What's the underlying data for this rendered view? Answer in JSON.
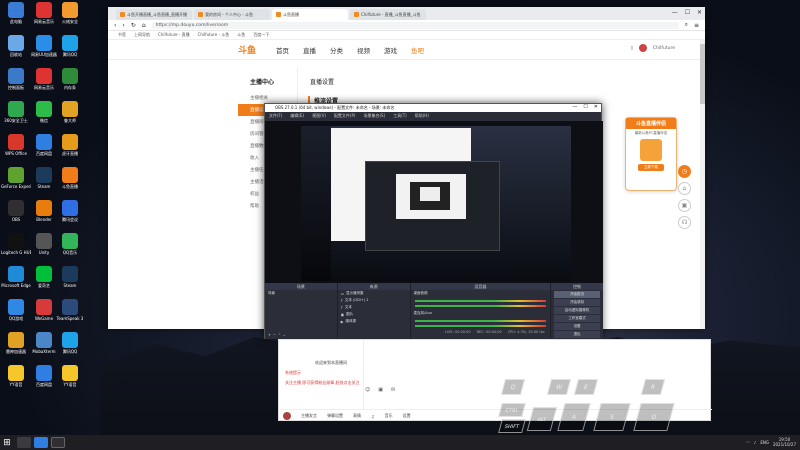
{
  "desktop": {
    "icons": [
      {
        "label": "此电脑",
        "color": "#3a7bd5"
      },
      {
        "label": "网易云音乐",
        "color": "#d33"
      },
      {
        "label": "火绒安全",
        "color": "#f29a2e"
      },
      {
        "label": "回收站",
        "color": "#6aa8e8"
      },
      {
        "label": "网易UU加速器",
        "color": "#2a8ee8"
      },
      {
        "label": "腾讯QQ",
        "color": "#1fa3e8"
      },
      {
        "label": "控制面板",
        "color": "#3d79c9"
      },
      {
        "label": "网易云音乐",
        "color": "#d33"
      },
      {
        "label": "内存条",
        "color": "#2f8a3a"
      },
      {
        "label": "360安全卫士",
        "color": "#2fa84f"
      },
      {
        "label": "微信",
        "color": "#2dbb4a"
      },
      {
        "label": "鲁大师",
        "color": "#e2a324"
      },
      {
        "label": "WPS Office",
        "color": "#d9362c"
      },
      {
        "label": "百度网盘",
        "color": "#2f7fe3"
      },
      {
        "label": "虎牙直播",
        "color": "#e69b1a"
      },
      {
        "label": "GeForce Experience",
        "color": "#5fa32e"
      },
      {
        "label": "Steam",
        "color": "#1c3b5a"
      },
      {
        "label": "斗鱼直播",
        "color": "#f07d1a"
      },
      {
        "label": "OBS",
        "color": "#302e31"
      },
      {
        "label": "Blender",
        "color": "#e87d0d"
      },
      {
        "label": "腾讯会议",
        "color": "#2f6fe3"
      },
      {
        "label": "Logitech G HUB",
        "color": "#111"
      },
      {
        "label": "Unity",
        "color": "#555"
      },
      {
        "label": "QQ音乐",
        "color": "#33b65a"
      },
      {
        "label": "Microsoft Edge",
        "color": "#1f8ad6"
      },
      {
        "label": "爱奇艺",
        "color": "#00bf3a"
      },
      {
        "label": "Steam",
        "color": "#1c3b5a"
      },
      {
        "label": "QQ游戏",
        "color": "#2f88e3"
      },
      {
        "label": "WeGame",
        "color": "#d73a3a"
      },
      {
        "label": "TeamSpeak 3",
        "color": "#2b4c7a"
      },
      {
        "label": "雷神加速器",
        "color": "#e0a124"
      },
      {
        "label": "MobaXterm",
        "color": "#4a86c8"
      },
      {
        "label": "腾讯QQ",
        "color": "#1fa3e8"
      },
      {
        "label": "YY语音",
        "color": "#f5c72a"
      },
      {
        "label": "百度网盘",
        "color": "#2f7fe3"
      },
      {
        "label": "YY语音",
        "color": "#f5c72a"
      }
    ],
    "taskbar": {
      "time": "19:50",
      "date": "2021/10/27",
      "lang": "ENG"
    }
  },
  "browser": {
    "tabs": [
      {
        "label": "斗鱼开播直播_斗鱼直播_直播开播"
      },
      {
        "label": "我的房间 - 个人中心 - 斗鱼"
      },
      {
        "label": "斗鱼直播"
      },
      {
        "label": "Chilfuture - 直播_斗鱼直播_斗鱼"
      }
    ],
    "url": "https://mp.douyu.com/live/room",
    "bookmarks": [
      "书签",
      "上网导航",
      "Chilfuture - 直播",
      "Chilfuture - 斗鱼",
      "斗鱼",
      "百度一下"
    ],
    "site": {
      "logo": "斗鱼",
      "nav": [
        "首页",
        "直播",
        "分类",
        "视频",
        "游戏",
        "鱼吧"
      ],
      "user": "Chilfuture",
      "sidebar_title": "主播中心",
      "sidebar_items": [
        "主播相关",
        "直播设置",
        "直播间",
        "房间管理",
        "直播数据",
        "收入",
        "主播任务",
        "主播活动",
        "权益",
        "帮助"
      ],
      "main_title": "直播设置",
      "sub_title": "推流设置"
    },
    "promo": {
      "title": "斗鱼直播伴侣",
      "desc": "最新斗鱼PC直播伴侣",
      "button": "立即下载"
    }
  },
  "obs": {
    "title": "OBS 27.0.1 (64 bit, windows) - 配置文件: 未命名 - 场景: 未命名",
    "menu": [
      "文件(F)",
      "编辑(E)",
      "视图(V)",
      "配置文件(P)",
      "场景集合(S)",
      "工具(T)",
      "帮助(H)"
    ],
    "docks": {
      "scenes": {
        "header": "场景",
        "items": [
          "场景"
        ]
      },
      "sources": {
        "header": "来源",
        "items": [
          "显示器采集",
          "文本 (GDI+) 2",
          "文本",
          "图片",
          "媒体源"
        ]
      },
      "mixer": {
        "header": "混音器",
        "items": [
          "桌面音频",
          "麦克风/Aux"
        ]
      },
      "transitions": {
        "header": "转场动画"
      },
      "controls": {
        "header": "控制",
        "items": [
          "开始推流",
          "开始录制",
          "启动虚拟摄像机",
          "工作室模式",
          "设置",
          "退出"
        ]
      }
    },
    "status": [
      "LIVE: 00:00:00",
      "REC: 00:00:00",
      "CPU: 4.3%, 30.00 fps"
    ]
  },
  "chat": {
    "lines": [
      "欢迎来到本直播间",
      "系统提示",
      "关注主播 即可获得粉丝勋章 赶快点击关注"
    ],
    "bottom": [
      "主播发言",
      "弹幕设置",
      "表情",
      "音乐",
      "设置"
    ]
  },
  "keyboard": {
    "keys": [
      "Q",
      "W",
      "E",
      "R",
      "CTRL",
      "SHIFT",
      "ALT",
      "A",
      "S",
      "D"
    ]
  }
}
